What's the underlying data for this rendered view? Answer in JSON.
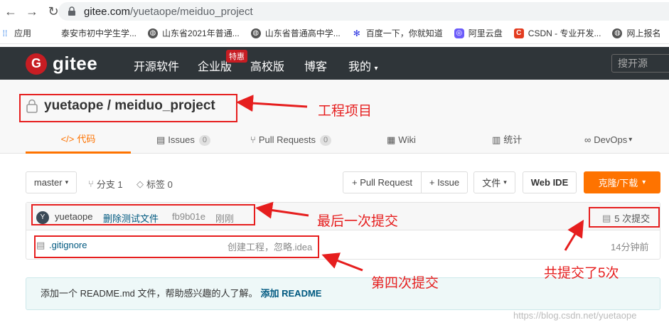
{
  "browser": {
    "url_host": "gitee.com",
    "url_path": "/yuetaope/meiduo_project"
  },
  "bookmarks": [
    {
      "label": "应用",
      "icon": "apps-grid-icon"
    },
    {
      "label": "泰安市初中学生学...",
      "icon": "page-icon"
    },
    {
      "label": "山东省2021年普通...",
      "icon": "globe-icon"
    },
    {
      "label": "山东省普通高中学...",
      "icon": "globe-icon"
    },
    {
      "label": "百度一下，你就知道",
      "icon": "baidu-paw-icon"
    },
    {
      "label": "阿里云盘",
      "icon": "aliyun-drive-icon"
    },
    {
      "label": "CSDN - 专业开发...",
      "icon": "csdn-icon"
    },
    {
      "label": "网上报名",
      "icon": "globe-icon"
    }
  ],
  "header": {
    "logo_text": "gitee",
    "logo_letter": "G",
    "nav": [
      "开源软件",
      "企业版",
      "高校版",
      "博客",
      "我的"
    ],
    "hot_badge": "特惠",
    "search_placeholder": "搜开源"
  },
  "repo": {
    "title": "yuetaope / meiduo_project",
    "tabs": [
      {
        "label": "代码",
        "prefix": "</>",
        "count": ""
      },
      {
        "label": "Issues",
        "count": "0"
      },
      {
        "label": "Pull Requests",
        "count": "0"
      },
      {
        "label": "Wiki",
        "count": ""
      },
      {
        "label": "统计",
        "count": ""
      },
      {
        "label": "DevOps",
        "count": ""
      }
    ]
  },
  "toolbar": {
    "branch": "master",
    "branches": "分支 1",
    "tags": "标签 0",
    "pull_request": "+ Pull Request",
    "issue": "+ Issue",
    "file": "文件",
    "web_ide": "Web IDE",
    "clone": "克隆/下载"
  },
  "commit": {
    "avatar_letter": "Y",
    "author": "yuetaope",
    "message": "删除测试文件",
    "hash": "fb9b01e",
    "time": "刚刚",
    "total": "5 次提交"
  },
  "files": [
    {
      "name": ".gitignore",
      "message": "创建工程，忽略.idea",
      "time": "14分钟前"
    }
  ],
  "readme": {
    "text": "添加一个 README.md 文件，帮助感兴趣的人了解。",
    "link": "添加 README"
  },
  "annotations": {
    "project": "工程项目",
    "last_commit": "最后一次提交",
    "fourth_commit": "第四次提交",
    "total_commits": "共提交了5次"
  },
  "watermark": "https://blog.csdn.net/yuetaope",
  "colors": {
    "brand": "#c71d23",
    "accent": "#fe7300",
    "header_bg": "#2f3539",
    "annotation": "#e61e1e"
  }
}
